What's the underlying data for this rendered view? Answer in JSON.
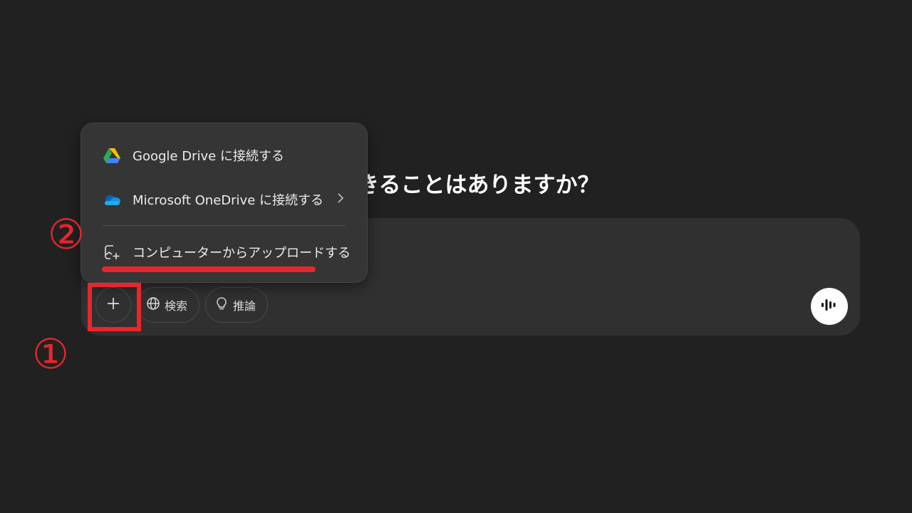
{
  "heading": "いできることはありますか？",
  "menu": {
    "items": [
      {
        "label": "Google Drive に接続する",
        "icon": "google-drive-icon"
      },
      {
        "label": "Microsoft OneDrive に接続する",
        "icon": "onedrive-icon",
        "has_submenu": true
      },
      {
        "label": "コンピューターからアップロードする",
        "icon": "upload-file-icon"
      }
    ]
  },
  "toolbar": {
    "plus_icon": "plus-icon",
    "search_label": "検索",
    "search_icon": "globe-icon",
    "reason_label": "推論",
    "reason_icon": "lightbulb-icon",
    "voice_icon": "voice-mode-icon"
  },
  "annotations": {
    "step1": "①",
    "step2": "②",
    "color": "#e8262c"
  },
  "colors": {
    "background": "#212121",
    "composer": "#303030",
    "menu": "#353535"
  }
}
